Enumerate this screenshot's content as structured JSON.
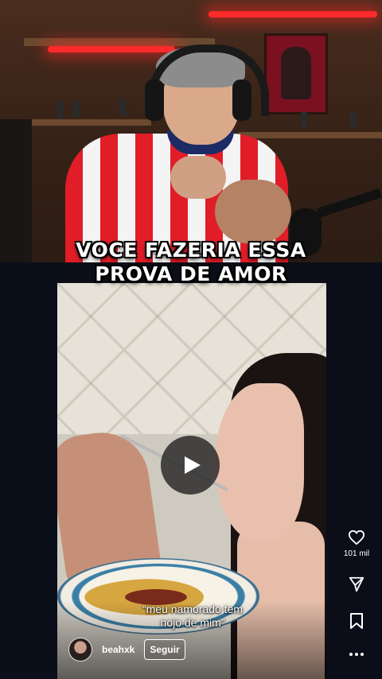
{
  "overlay": {
    "line1": "VOCE FAZERIA ESSA",
    "line2": "PROVA DE AMOR"
  },
  "video": {
    "caption_line1": "“meu namorado tem",
    "caption_line2": "nojo de mim”",
    "channel_name": "beahxk",
    "follow_label": "Seguir",
    "play_icon": "play-icon"
  },
  "actions": {
    "like_count": "101 mil",
    "like_icon": "heart-icon",
    "share_icon": "send-icon",
    "save_icon": "bookmark-icon",
    "more_icon": "more-dots-icon"
  },
  "colors": {
    "neon": "#ff2a2a",
    "jersey_red": "#e11d27",
    "background": "#0c0f17"
  }
}
